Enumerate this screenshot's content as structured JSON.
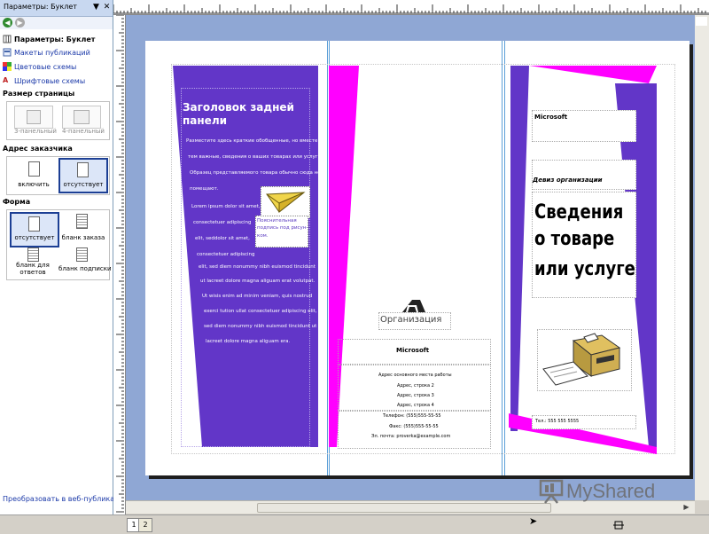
{
  "taskpane": {
    "title": "Параметры: Буклет",
    "menu_glyph": "▼",
    "close_glyph": "✕",
    "nav": {
      "back_icon": "back-arrow-icon",
      "forward_icon": "forward-arrow-icon"
    },
    "links": [
      {
        "label": "Параметры: Буклет",
        "icon": "brochure-options-icon",
        "bold": true
      },
      {
        "label": "Макеты публикаций",
        "icon": "publication-designs-icon"
      },
      {
        "label": "Цветовые схемы",
        "icon": "color-schemes-icon"
      },
      {
        "label": "Шрифтовые схемы",
        "icon": "font-schemes-icon"
      }
    ],
    "page_size": {
      "heading": "Размер страницы",
      "options": [
        {
          "label": "3-панельный",
          "enabled": false
        },
        {
          "label": "4-панельный",
          "enabled": false
        }
      ]
    },
    "customer_address": {
      "heading": "Адрес заказчика",
      "options": [
        {
          "label": "включить",
          "selected": false
        },
        {
          "label": "отсутствует",
          "selected": true
        }
      ]
    },
    "form": {
      "heading": "Форма",
      "options": [
        {
          "label": "отсутствует",
          "selected": true
        },
        {
          "label": "бланк заказа",
          "selected": false
        },
        {
          "label": "бланк для ответов",
          "selected": false
        },
        {
          "label": "бланк подписки",
          "selected": false
        }
      ]
    },
    "convert_link": "Преобразовать в веб-публикацию..."
  },
  "pages": {
    "tabs": [
      "1",
      "2"
    ]
  },
  "brochure": {
    "colors": {
      "purple": "#6236c8",
      "magenta": "#ff00ff",
      "guide": "#5b9fd8"
    },
    "left_panel": {
      "heading": "Заголовок задней панели",
      "intro_lines": [
        "Разместите здесь краткие обобщенные, но вместе с",
        "тем важные, сведения о ваших товарах или услугах.",
        "Образец представляемого товара обычно сюда не",
        "помещают."
      ],
      "lorem_lines": [
        "Lorem ipsum dolor sit amet,",
        "consectetuer adipiscing",
        "elit, seddolor sit amet,",
        "consectetuer adipiscing",
        "elit, sed diem nonummy nibh euismod tincidunt",
        "ut lacreet dolore magna aliguam erat volutpat.",
        "Ut wisis enim ad minim veniam, quis nostrud",
        "exerci tution ullat consectetuer adipiscing elit,",
        "sed diem nonummy nibh euismod tincidunt ut",
        "lacreet dolore magna aliguam era."
      ],
      "caption_lines": [
        "Пояснительная",
        "подпись под рисун-",
        "ком."
      ],
      "image_icon": "paper-plane-icon"
    },
    "middle_panel": {
      "org_label": "Организация",
      "company": "Microsoft",
      "address_lines": [
        "Адрес основного места работы",
        "Адрес, строка 2",
        "Адрес, строка 3",
        "Адрес, строка 4"
      ],
      "contact_lines": [
        "Телефон: (555)555-55-55",
        "Факс: (555)555-55-55",
        "Эл. почта: proverka@example.com"
      ],
      "logo_icon": "organization-logo-icon"
    },
    "right_panel": {
      "company": "Microsoft",
      "slogan": "Девиз организации",
      "title_lines": [
        "Сведения",
        "о товаре",
        "или услуге"
      ],
      "phone": "Тел.: 555 555 5555",
      "image_icon": "printer-icon"
    }
  },
  "watermark": {
    "text": "MyShared",
    "icon": "presentation-board-icon"
  },
  "statusbar": {
    "cursor_icon": "cursor-arrow-icon",
    "size_icon": "object-size-icon"
  }
}
